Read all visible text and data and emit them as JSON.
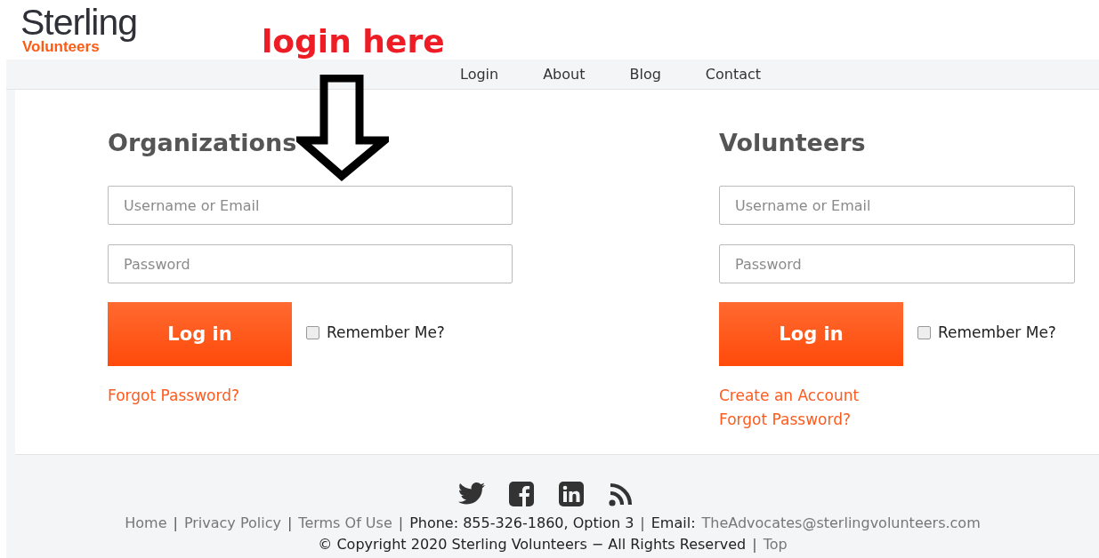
{
  "logo": {
    "name": "Sterling",
    "tagline": "Volunteers"
  },
  "annotation": {
    "text": "login here"
  },
  "nav": [
    {
      "label": "Login"
    },
    {
      "label": "About"
    },
    {
      "label": "Blog"
    },
    {
      "label": "Contact"
    }
  ],
  "panels": [
    {
      "title": "Organizations",
      "username_placeholder": "Username or Email",
      "password_placeholder": "Password",
      "button": "Log in",
      "remember": {
        "label": "Remember Me?",
        "checked": false
      },
      "links": [
        "Forgot Password?"
      ]
    },
    {
      "title": "Volunteers",
      "username_placeholder": "Username or Email",
      "password_placeholder": "Password",
      "button": "Log in",
      "remember": {
        "label": "Remember Me?",
        "checked": false
      },
      "links": [
        "Create an Account",
        "Forgot Password?"
      ]
    }
  ],
  "social": [
    {
      "kind": "bird"
    },
    {
      "kind": "f"
    },
    {
      "kind": "in"
    },
    {
      "kind": "rss"
    }
  ],
  "footer_lines": [
    [
      {
        "text": "Home",
        "kind": "link"
      },
      {
        "text": "|",
        "kind": "sep"
      },
      {
        "text": "Privacy Policy",
        "kind": "link"
      },
      {
        "text": "|",
        "kind": "sep"
      },
      {
        "text": "Terms Of Use",
        "kind": "link"
      },
      {
        "text": "|",
        "kind": "sep"
      },
      {
        "text": "Phone: 855-326-1860, Option 3",
        "kind": "plain"
      },
      {
        "text": "|",
        "kind": "sep"
      },
      {
        "text": "Email:",
        "kind": "plain"
      },
      {
        "text": "TheAdvocates@sterlingvolunteers.com",
        "kind": "link"
      }
    ],
    [
      {
        "text": "© Copyright 2020 Sterling Volunteers − All Rights Reserved",
        "kind": "plain"
      },
      {
        "text": "|",
        "kind": "sep"
      },
      {
        "text": "Top",
        "kind": "link"
      }
    ]
  ]
}
